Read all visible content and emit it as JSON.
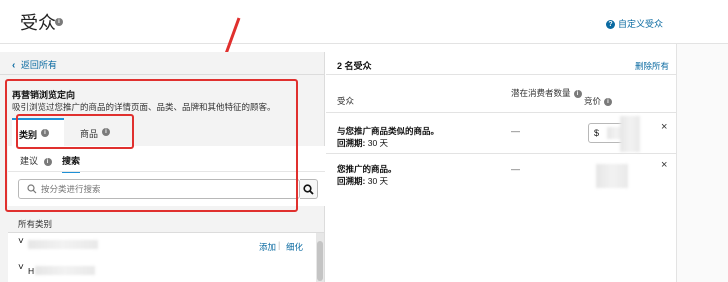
{
  "header": {
    "title": "受众",
    "custom_audience_link": "自定义受众"
  },
  "left_panel": {
    "back_link": "返回所有",
    "section_title": "再营销浏览定向",
    "section_desc": "吸引浏览过您推广的商品的详情页面、品类、品牌和其他特征的顾客。",
    "tabs": [
      {
        "label": "类别",
        "active": true
      },
      {
        "label": "商品",
        "active": false
      }
    ],
    "subtabs": [
      {
        "label": "建议",
        "active": false
      },
      {
        "label": "搜索",
        "active": true
      }
    ],
    "search": {
      "placeholder": "按分类进行搜索",
      "value": ""
    },
    "all_categories_label": "所有类别",
    "category_actions": {
      "add": "添加",
      "refine": "细化"
    },
    "category_rows": [
      {
        "expander": "˅",
        "label": ""
      },
      {
        "expander": "˅",
        "label": "H"
      }
    ]
  },
  "right_panel": {
    "count_label": "2 名受众",
    "remove_all": "删除所有",
    "columns": {
      "audience": "受众",
      "potential": "潜在消费者数量",
      "bid": "竞价"
    },
    "rows": [
      {
        "title": "与您推广商品类似的商品。",
        "lookback_label": "回溯期:",
        "lookback_value": "30 天",
        "potential": "—",
        "bid_currency": "$"
      },
      {
        "title": "您推广的商品。",
        "lookback_label": "回溯期:",
        "lookback_value": "30 天",
        "potential": "—"
      }
    ]
  },
  "colors": {
    "accent_link": "#0a6aa1",
    "annotation_red": "#e0302e",
    "active_tab_underline": "#1e90d6",
    "panel_bg": "#f3f3f3"
  }
}
